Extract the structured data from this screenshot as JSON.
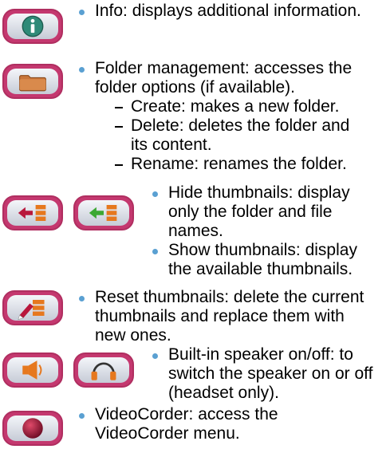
{
  "items": [
    {
      "icon": "info-icon",
      "lines": [
        "Info: displays additional information."
      ]
    },
    {
      "icon": "folder-icon",
      "lines": [
        "Folder management: accesses the",
        "folder options (if available)."
      ],
      "sub": [
        {
          "lines": [
            "Create: makes a new folder."
          ]
        },
        {
          "lines": [
            "Delete: deletes the folder and",
            "its content."
          ]
        },
        {
          "lines": [
            "Rename: renames the folder."
          ]
        }
      ]
    },
    {
      "icons": [
        "hide-thumbnails-icon",
        "show-thumbnails-icon"
      ],
      "entries": [
        {
          "lines": [
            "Hide thumbnails: display",
            "only the folder and file",
            "names."
          ]
        },
        {
          "lines": [
            "Show thumbnails: display",
            "the available thumbnails."
          ]
        }
      ]
    },
    {
      "icon": "reset-thumbnails-icon",
      "lines": [
        "Reset thumbnails: delete the current",
        "thumbnails and replace them with",
        "new ones."
      ]
    },
    {
      "icons": [
        "speaker-icon",
        "headset-icon"
      ],
      "lines": [
        "Built-in speaker on/off: to",
        "switch the speaker on or off",
        "(headset only)."
      ]
    },
    {
      "icon": "videocorder-icon",
      "lines": [
        "VideoCorder: access the",
        "VideoCorder menu."
      ]
    }
  ],
  "colors": {
    "bullet": "#5aa0d2",
    "button_border": "#c4386f"
  }
}
